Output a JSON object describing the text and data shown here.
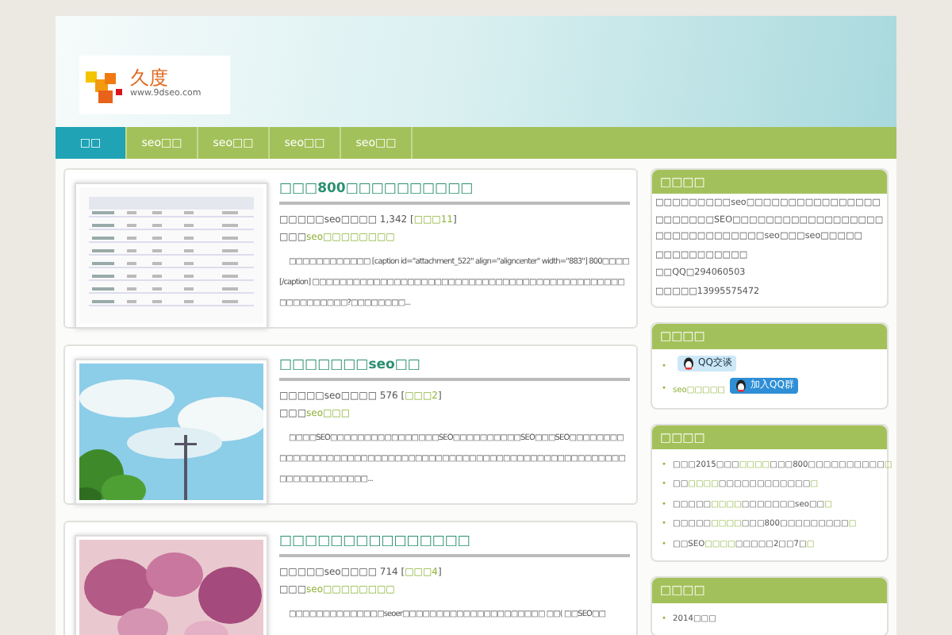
{
  "logo": {
    "name": "久度",
    "url": "www.9dseo.com"
  },
  "nav": [
    {
      "label": "□□",
      "selected": true
    },
    {
      "label": "seo□□",
      "selected": false
    },
    {
      "label": "seo□□",
      "selected": false
    },
    {
      "label": "seo□□",
      "selected": false
    },
    {
      "label": "seo□□",
      "selected": false
    }
  ],
  "posts": [
    {
      "title": "□□□800□□□□□□□□□□",
      "meta": [
        [
          {
            "text": "□□□□□seo□□□□ 1,342 [",
            "link": false
          },
          {
            "text": "□□□11",
            "link": true
          },
          {
            "text": "]",
            "link": false
          }
        ],
        [
          {
            "text": "□□□",
            "link": false
          },
          {
            "text": "seo□□□□□□□□",
            "link": true
          }
        ]
      ],
      "excerpt": "□□□□□□□□□□□□ [caption id=\"attachment_522\" align=\"aligncenter\" width=\"883\"] 800□□□□[/caption] □□□□□□□□□□□□□□□□□□□□□□□□□□□□□□□□□□□□□□□□□□□□□□□□□□□□□□□□?□□□□□□□□..."
    },
    {
      "title": "□□□□□□□seo□□",
      "meta": [
        [
          {
            "text": "□□□□□seo□□□□ 576 [",
            "link": false
          },
          {
            "text": "□□□2",
            "link": true
          },
          {
            "text": "]",
            "link": false
          }
        ],
        [
          {
            "text": "□□□",
            "link": false
          },
          {
            "text": "seo□□□",
            "link": true
          }
        ]
      ],
      "excerpt": "□□□□SEO□□□□□□□□□□□□□□□□SEO□□□□□□□□□□SEO□□□SEO□□□□□□□□□□□□□□□□□□□□□□□□□□□□□□□□□□□□□□□□□□□□□□□□□□□□□□□□□□□□□□□□□□□□□□□□..."
    },
    {
      "title": "□□□□□□□□□□□□□□□",
      "meta": [
        [
          {
            "text": "□□□□□seo□□□□ 714 [",
            "link": false
          },
          {
            "text": "□□□4",
            "link": true
          },
          {
            "text": "]",
            "link": false
          }
        ],
        [
          {
            "text": "□□□",
            "link": false
          },
          {
            "text": "seo□□□□□□□□",
            "link": true
          }
        ]
      ],
      "excerpt": "□□□□□□□□□□□□□□seoer□□□□□□□□□□□□□□□□□□□□□ □□( □□SEO□□"
    }
  ],
  "sidebar": [
    {
      "title": "□□□□",
      "kind": "text",
      "lines": [
        "□□□□□□□□□seo□□□□□□□□□□□□□□□□□□□□□□□SEO□□□□□□□□□□□□□□□□□□□□□□□□□□□□□□□seo□□□seo□□□□□",
        "□□□□□□□□□□□",
        "□□QQ□294060503",
        "□□□□□13995575472"
      ]
    },
    {
      "title": "□□□□",
      "kind": "contacts",
      "items": [
        {
          "marker": "•",
          "badge": "QQ交谈",
          "kind": "chat"
        },
        {
          "marker": "•",
          "text": "seo□□□□□",
          "badge": "加入QQ群",
          "kind": "group"
        }
      ]
    },
    {
      "title": "□□□□",
      "kind": "links",
      "items": [
        {
          "marker": "•",
          "parts": [
            {
              "text": "□□□2015□□□",
              "link": false
            },
            {
              "text": "□□□□",
              "link": true
            },
            {
              "text": "□□□800□□□□□□□□□□",
              "link": false
            },
            {
              "text": "□",
              "link": true
            }
          ]
        },
        {
          "marker": "•",
          "parts": [
            {
              "text": "□□",
              "link": false
            },
            {
              "text": "□□□□",
              "link": true
            },
            {
              "text": "□□□□□□□□□□□□",
              "link": false
            },
            {
              "text": "□",
              "link": true
            }
          ]
        },
        {
          "marker": "•",
          "parts": [
            {
              "text": "□□□□□",
              "link": false
            },
            {
              "text": "□□□□",
              "link": true
            },
            {
              "text": "□□□□□□□seo□□",
              "link": false
            },
            {
              "text": "□",
              "link": true
            }
          ]
        },
        {
          "marker": "•",
          "parts": [
            {
              "text": "□□□□□",
              "link": false
            },
            {
              "text": "□□□□",
              "link": true
            },
            {
              "text": "□□□800□□□□□□□□□",
              "link": false
            },
            {
              "text": "□",
              "link": true
            }
          ]
        },
        {
          "marker": "•",
          "parts": [
            {
              "text": "□□SEO",
              "link": false
            },
            {
              "text": "□□□□",
              "link": true
            },
            {
              "text": "□□□□□2□□7□",
              "link": false
            },
            {
              "text": "□",
              "link": true
            }
          ]
        }
      ]
    },
    {
      "title": "□□□□",
      "kind": "links",
      "items": [
        {
          "marker": "•",
          "parts": [
            {
              "text": "2014□□□",
              "link": false
            }
          ]
        }
      ]
    }
  ]
}
